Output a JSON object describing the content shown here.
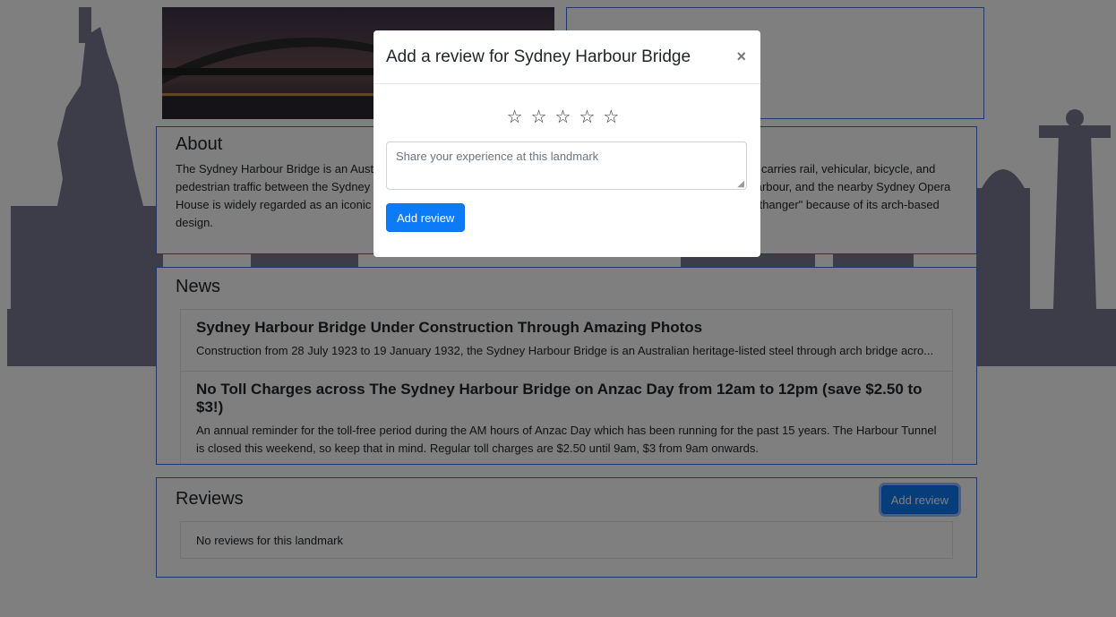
{
  "about": {
    "title": "About",
    "text": "The Sydney Harbour Bridge is an Australian heritage-listed steel through arch bridge across Sydney Harbour that carries rail, vehicular, bicycle, and pedestrian traffic between the Sydney central business district and the North Shore. The view of the bridge, the harbour, and the nearby Sydney Opera House is widely regarded as an iconic image of Sydney, and of Australia itself. The bridge is nicknamed \"The Coathanger\" because of its arch-based design."
  },
  "news": {
    "title": "News",
    "items": [
      {
        "title": "Sydney Harbour Bridge Under Construction Through Amazing Photos",
        "body": "Construction from 28 July 1923 to 19 January 1932, the Sydney Harbour Bridge is an Australian heritage-listed steel through arch bridge acro..."
      },
      {
        "title": "No Toll Charges across The Sydney Harbour Bridge on Anzac Day from 12am to 12pm (save $2.50 to $3!)",
        "body": "An annual reminder for the toll-free period during the AM hours of Anzac Day which has been running for the past 15 years. The Harbour Tunnel is closed this weekend, so keep that in mind. Regular toll charges are $2.50 until 9am, $3 from 9am onwards."
      }
    ]
  },
  "reviews": {
    "title": "Reviews",
    "add_button": "Add review",
    "empty_text": "No reviews for this landmark"
  },
  "modal": {
    "title": "Add a review for Sydney Harbour Bridge",
    "close": "×",
    "stars": [
      "☆",
      "☆",
      "☆",
      "☆",
      "☆"
    ],
    "rating": 0,
    "placeholder": "Share your experience at this landmark",
    "value": "",
    "submit": "Add review"
  },
  "colors": {
    "accent": "#0d7bf7",
    "card_border": "#3d6fd9",
    "silhouette": "#7b7b95"
  }
}
